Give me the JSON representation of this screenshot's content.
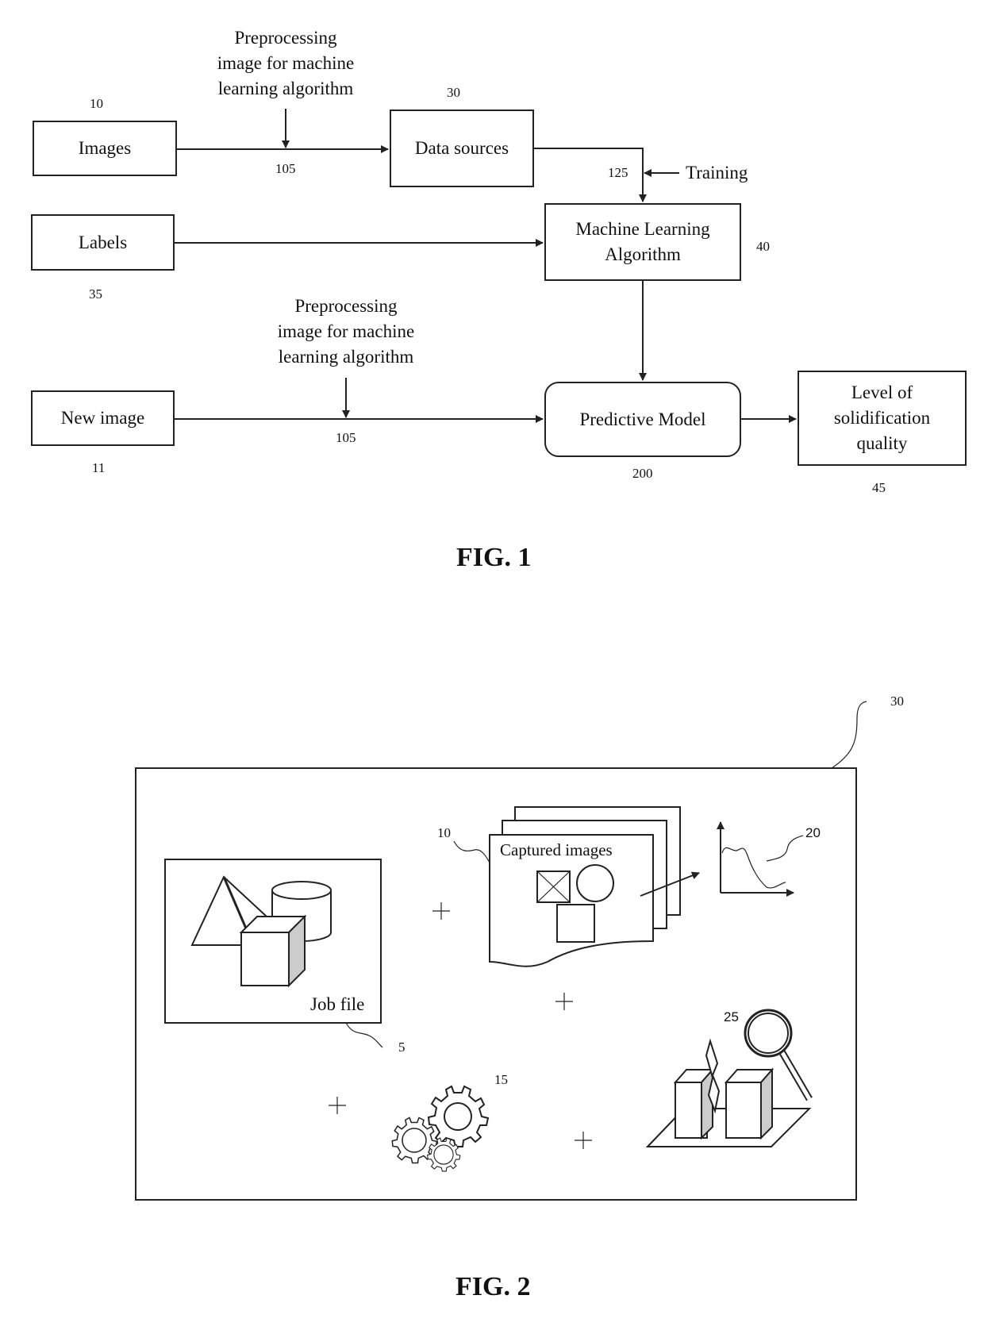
{
  "fig1": {
    "caption": "FIG. 1",
    "nodes": {
      "images": {
        "label": "Images",
        "ref": "10"
      },
      "data_sources": {
        "label": "Data sources",
        "ref": "30"
      },
      "labels": {
        "label": "Labels",
        "ref": "35"
      },
      "ml_algorithm": {
        "label_line1": "Machine Learning",
        "label_line2": "Algorithm",
        "ref": "40"
      },
      "new_image": {
        "label": "New image",
        "ref": "11"
      },
      "predictive_model": {
        "label": "Predictive Model",
        "ref": "200"
      },
      "quality": {
        "label_line1": "Level of",
        "label_line2": "solidification",
        "label_line3": "quality",
        "ref": "45"
      }
    },
    "preprocess_top": {
      "line1": "Preprocessing",
      "line2": "image for machine",
      "line3": "learning algorithm",
      "ref": "105"
    },
    "preprocess_bottom": {
      "line1": "Preprocessing",
      "line2": "image for machine",
      "line3": "learning algorithm",
      "ref": "105"
    },
    "training": {
      "label": "Training",
      "ref": "125"
    }
  },
  "fig2": {
    "caption": "FIG. 2",
    "container_ref": "30",
    "job_file": {
      "label": "Job file",
      "ref": "5"
    },
    "captured_images": {
      "label": "Captured images",
      "ref": "10"
    },
    "graph_ref": "20",
    "gears_ref": "15",
    "inspection_ref": "25",
    "plus_sign": "+"
  }
}
